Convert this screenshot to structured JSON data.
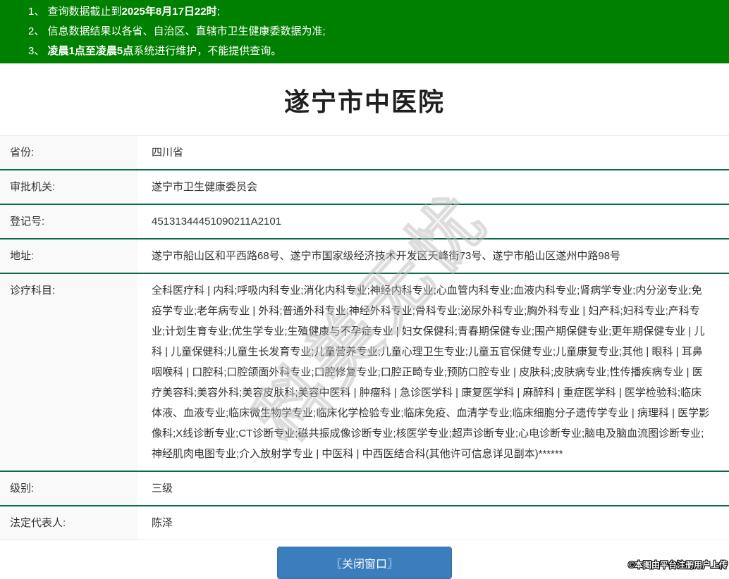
{
  "notice_banner": {
    "bg_color": "#008001",
    "items": [
      {
        "segments": [
          {
            "text": "1、 查询数据截止到",
            "bold": false
          },
          {
            "text": "2025年8月17日22时",
            "bold": true
          },
          {
            "text": ";",
            "bold": false
          }
        ]
      },
      {
        "segments": [
          {
            "text": "2、 信息数据结果以各省、自治区、直辖市卫生健康委数据为准;",
            "bold": false
          }
        ]
      },
      {
        "segments": [
          {
            "text": "3、 ",
            "bold": false
          },
          {
            "text": "凌晨1点至凌晨5点",
            "bold": true
          },
          {
            "text": "系统进行维护，不能提供查询。",
            "bold": false
          }
        ]
      }
    ]
  },
  "page_title": "遂宁市中医院",
  "details": {
    "separator_color": "#0a6b44",
    "label_bg_color": "#f9f9f9",
    "rows": [
      {
        "label": "省份:",
        "value": "四川省"
      },
      {
        "label": "审批机关:",
        "value": "遂宁市卫生健康委员会"
      },
      {
        "label": "登记号:",
        "value": "45131344451090211A2101"
      },
      {
        "label": "地址:",
        "value": "遂宁市船山区和平西路68号、遂宁市国家级经济技术开发区天峰街73号、遂宁市船山区遂州中路98号"
      },
      {
        "label": "诊疗科目:",
        "value": "全科医疗科 | 内科;呼吸内科专业;消化内科专业;神经内科专业;心血管内科专业;血液内科专业;肾病学专业;内分泌专业;免疫学专业;老年病专业 | 外科;普通外科专业;神经外科专业;骨科专业;泌尿外科专业;胸外科专业 | 妇产科;妇科专业;产科专业;计划生育专业;优生学专业;生殖健康与不孕症专业 | 妇女保健科;青春期保健专业;围产期保健专业;更年期保健专业 | 儿科 | 儿童保健科;儿童生长发育专业;儿童营养专业;儿童心理卫生专业;儿童五官保健专业;儿童康复专业;其他 | 眼科 | 耳鼻咽喉科 | 口腔科;口腔颌面外科专业;口腔修复专业;口腔正畸专业;预防口腔专业 | 皮肤科;皮肤病专业;性传播疾病专业 | 医疗美容科;美容外科;美容皮肤科;美容中医科 | 肿瘤科 | 急诊医学科 | 康复医学科 | 麻醉科 | 重症医学科 | 医学检验科;临床体液、血液专业;临床微生物学专业;临床化学检验专业;临床免疫、血清学专业;临床细胞分子遗传学专业 | 病理科 | 医学影像科;X线诊断专业;CT诊断专业;磁共振成像诊断专业;核医学专业;超声诊断专业;心电诊断专业;脑电及脑血流图诊断专业;神经肌肉电图专业;介入放射学专业 | 中医科 | 中西医结合科(其他许可信息详见副本)******"
      },
      {
        "label": "级别:",
        "value": "三级"
      },
      {
        "label": "法定代表人:",
        "value": "陈泽"
      }
    ]
  },
  "close_button": {
    "label": "〖关闭窗口〗",
    "bg_color": "#3c7ebd"
  },
  "watermark_text": "科美无忧",
  "footer_note": "©本图由平台注册用户上传"
}
